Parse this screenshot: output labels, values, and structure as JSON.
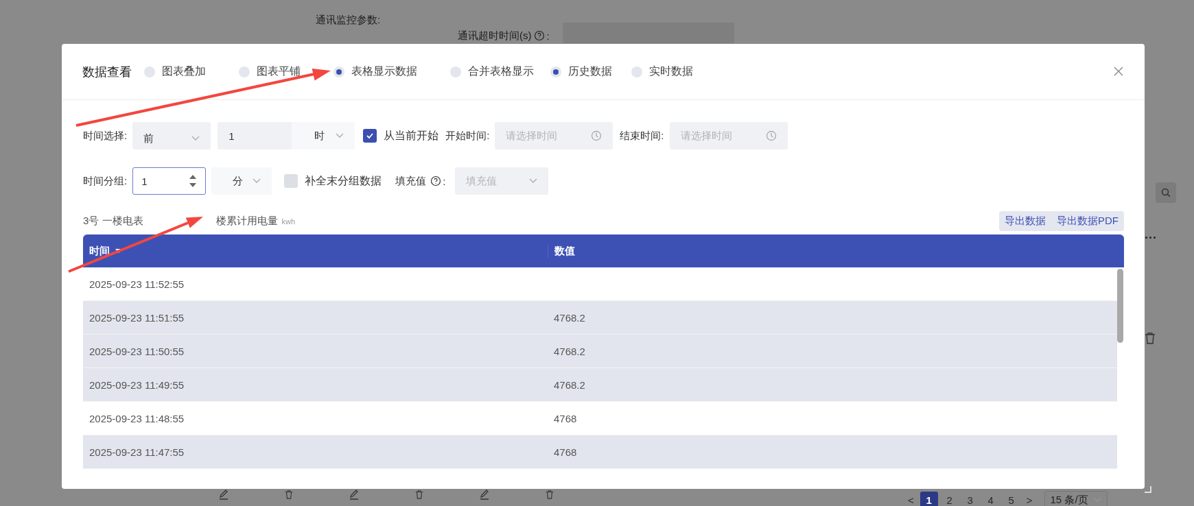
{
  "backdrop": {
    "section_label": "通讯监控参数:",
    "timeout_label": "通讯超时时间(s)",
    "timeout_suffix": ":",
    "pagination": {
      "prev": "<",
      "next": ">",
      "pages": [
        {
          "label": "1",
          "selected": true
        },
        {
          "label": "2",
          "selected": false
        },
        {
          "label": "3",
          "selected": false
        },
        {
          "label": "4",
          "selected": false
        },
        {
          "label": "5",
          "selected": false
        }
      ],
      "page_size": "15 条/页"
    }
  },
  "dialog": {
    "title": "数据查看",
    "view_modes": [
      {
        "label": "图表叠加",
        "selected": false
      },
      {
        "label": "图表平铺",
        "selected": false
      },
      {
        "label": "表格显示数据",
        "selected": true
      },
      {
        "label": "合并表格显示",
        "selected": false
      }
    ],
    "data_sources": [
      {
        "label": "历史数据",
        "selected": true
      },
      {
        "label": "实时数据",
        "selected": false
      }
    ],
    "time_select": {
      "label": "时间选择:",
      "direction": "前",
      "amount": "1",
      "unit": "时",
      "from_now": {
        "label": "从当前开始",
        "checked": true
      },
      "start_label": "开始时间:",
      "start_placeholder": "请选择时间",
      "end_label": "结束时间:",
      "end_placeholder": "请选择时间"
    },
    "time_group": {
      "label": "时间分组:",
      "value": "1",
      "unit": "分",
      "fill_missing": {
        "label": "补全末分组数据",
        "checked": false
      },
      "fill_label": "填充值",
      "fill_suffix": ":",
      "fill_placeholder": "填充值"
    },
    "series": {
      "device": "3号 一楼电表",
      "name": "楼累计用电量",
      "unit": "kwh"
    },
    "buttons": [
      "导出数据",
      "导出数据PDF"
    ],
    "table": {
      "columns": [
        "时间",
        "数值"
      ],
      "rows": [
        {
          "time": "2025-09-23 11:52:55",
          "selected": false
        },
        {
          "time": "2025-09-23 11:51:55",
          "value": "4768.2",
          "selected": true
        },
        {
          "time": "2025-09-23 11:50:55",
          "value": "4768.2",
          "selected": true
        },
        {
          "time": "2025-09-23 11:49:55",
          "value": "4768.2",
          "selected": true
        },
        {
          "time": "2025-09-23 11:48:55",
          "value": "4768",
          "selected": false
        },
        {
          "time": "2025-09-23 11:47:55",
          "value": "4768",
          "selected": true
        }
      ]
    }
  }
}
